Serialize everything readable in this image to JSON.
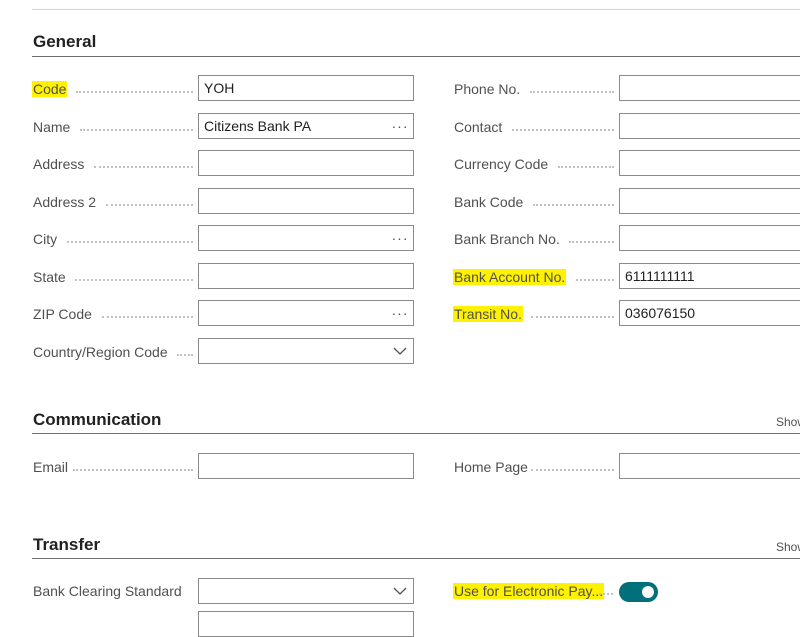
{
  "general": {
    "title": "General",
    "left": [
      {
        "label": "Code",
        "value": "YOH",
        "control": "text",
        "highlight": true
      },
      {
        "label": "Name",
        "value": "Citizens Bank PA",
        "control": "lookup",
        "highlight": false
      },
      {
        "label": "Address",
        "value": "",
        "control": "text",
        "highlight": false
      },
      {
        "label": "Address 2",
        "value": "",
        "control": "text",
        "highlight": false
      },
      {
        "label": "City",
        "value": "",
        "control": "lookup",
        "highlight": false
      },
      {
        "label": "State",
        "value": "",
        "control": "text",
        "highlight": false
      },
      {
        "label": "ZIP Code",
        "value": "",
        "control": "lookup",
        "highlight": false
      },
      {
        "label": "Country/Region Code",
        "value": "",
        "control": "dropdown",
        "highlight": false
      }
    ],
    "right": [
      {
        "label": "Phone No.",
        "value": "",
        "control": "text",
        "highlight": false
      },
      {
        "label": "Contact",
        "value": "",
        "control": "text",
        "highlight": false
      },
      {
        "label": "Currency Code",
        "value": "",
        "control": "text",
        "highlight": false
      },
      {
        "label": "Bank Code",
        "value": "",
        "control": "text",
        "highlight": false
      },
      {
        "label": "Bank Branch No.",
        "value": "",
        "control": "text",
        "highlight": false
      },
      {
        "label": "Bank Account No.",
        "value": "6111111111",
        "control": "text",
        "highlight": true
      },
      {
        "label": "Transit No.",
        "value": "036076150",
        "control": "text",
        "highlight": true
      }
    ]
  },
  "communication": {
    "title": "Communication",
    "show_more": "Show",
    "email_label": "Email",
    "email_value": "",
    "home_page_label": "Home Page",
    "home_page_value": ""
  },
  "transfer": {
    "title": "Transfer",
    "show_more": "Show",
    "bank_clearing_label": "Bank Clearing Standard",
    "bank_clearing_value": "",
    "electronic_payment_label": "Use for Electronic Pay...",
    "electronic_payment_on": true
  },
  "ellipsis_glyph": "···",
  "colors": {
    "highlight": "#fff200",
    "toggle_on": "#00707a",
    "section_rule": "#6e6e6e"
  }
}
